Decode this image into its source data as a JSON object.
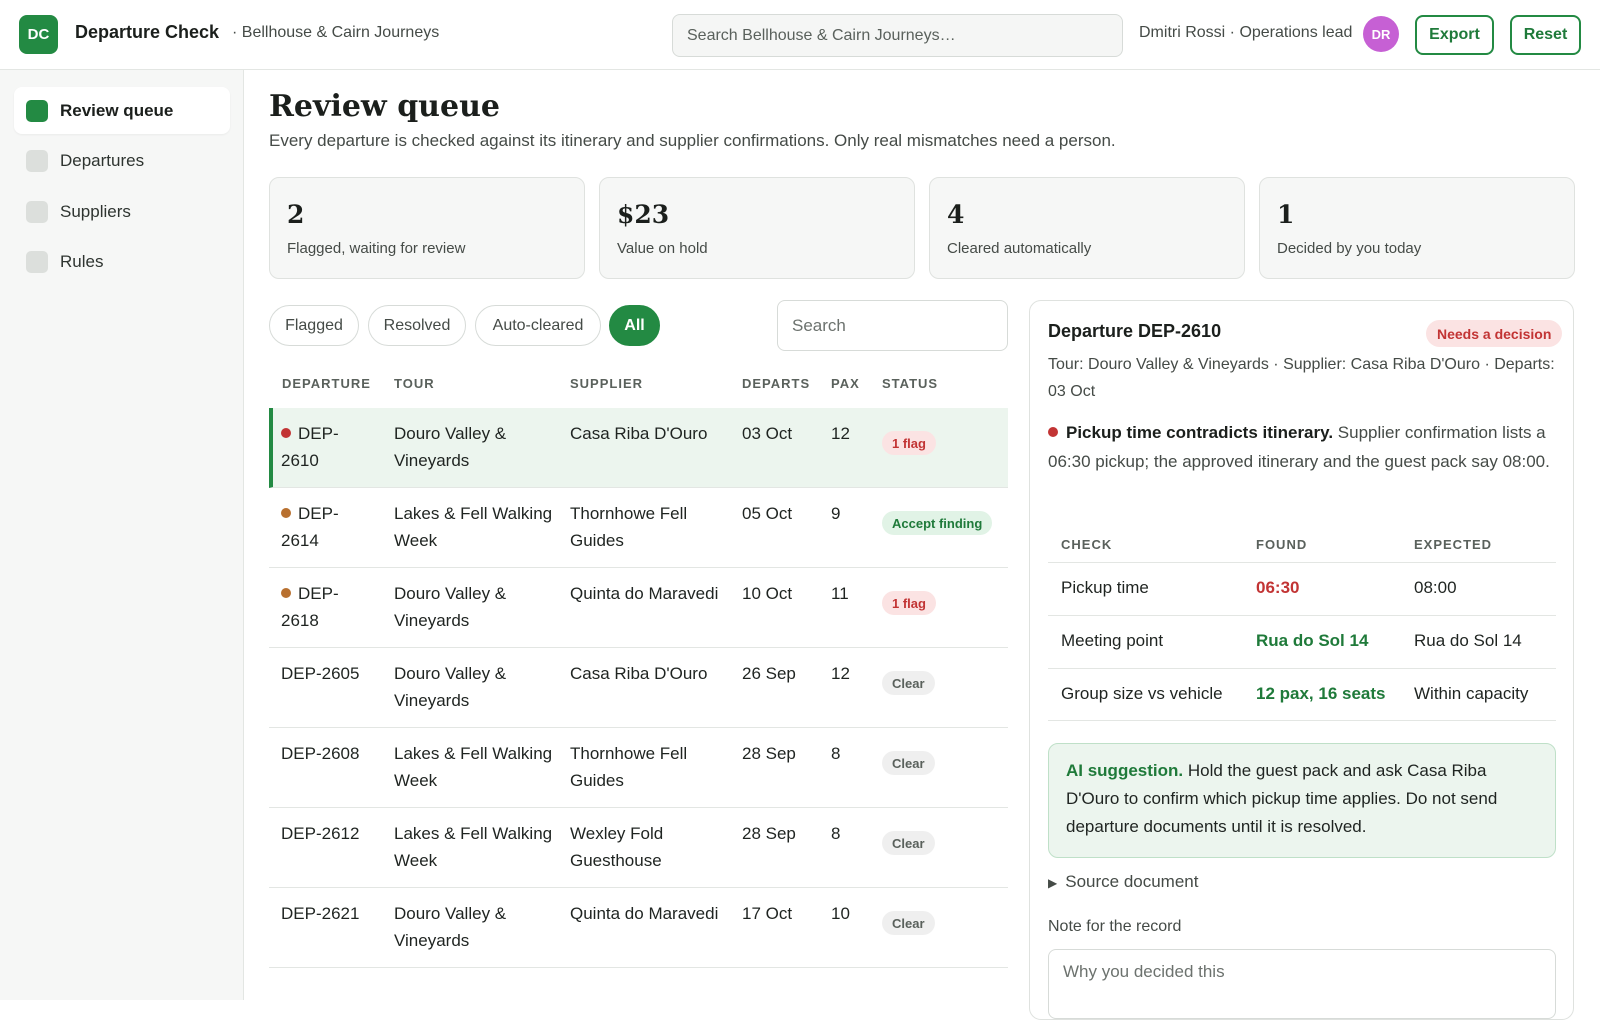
{
  "app": {
    "logo_initials": "DC",
    "name": "Departure Check",
    "org": "· Bellhouse & Cairn Journeys",
    "search_placeholder": "Search Bellhouse & Cairn Journeys…",
    "user": "Dmitri Rossi · Operations lead",
    "avatar_initials": "DR",
    "export_label": "Export",
    "reset_label": "Reset",
    "accent_color": "#238a43",
    "avatar_color": "#c660d4"
  },
  "sidebar": {
    "items": [
      {
        "label": "Review queue",
        "active": true
      },
      {
        "label": "Departures"
      },
      {
        "label": "Suppliers"
      },
      {
        "label": "Rules"
      }
    ]
  },
  "main": {
    "title": "Review queue",
    "subtitle": "Every departure is checked against its itinerary and supplier confirmations. Only real mismatches need a person.",
    "stats": [
      {
        "value": "2",
        "label": "Flagged, waiting for review"
      },
      {
        "value": "$23",
        "label": "Value on hold"
      },
      {
        "value": "4",
        "label": "Cleared automatically"
      },
      {
        "value": "1",
        "label": "Decided by you today"
      }
    ],
    "filters": [
      "Flagged",
      "Resolved",
      "Auto-cleared",
      "All"
    ],
    "active_filter": "All",
    "table_search_placeholder": "Search",
    "columns": [
      "DEPARTURE",
      "TOUR",
      "SUPPLIER",
      "DEPARTS",
      "PAX",
      "STATUS"
    ],
    "rows": [
      {
        "id": "DEP-2610",
        "tour": "Douro Valley & Vineyards",
        "supplier": "Casa Riba D'Ouro",
        "departs": "03 Oct",
        "pax": "12",
        "status": "1 flag",
        "status_kind": "flag",
        "dot": "#c23434",
        "selected": true
      },
      {
        "id": "DEP-2614",
        "tour": "Lakes & Fell Walking Week",
        "supplier": "Thornhowe Fell Guides",
        "departs": "05 Oct",
        "pax": "9",
        "status": "Accept finding",
        "status_kind": "accept",
        "dot": "#b8702f"
      },
      {
        "id": "DEP-2618",
        "tour": "Douro Valley & Vineyards",
        "supplier": "Quinta do Maravedi",
        "departs": "10 Oct",
        "pax": "11",
        "status": "1 flag",
        "status_kind": "flag",
        "dot": "#b8702f"
      },
      {
        "id": "DEP-2605",
        "tour": "Douro Valley & Vineyards",
        "supplier": "Casa Riba D'Ouro",
        "departs": "26 Sep",
        "pax": "12",
        "status": "Clear",
        "status_kind": "clear"
      },
      {
        "id": "DEP-2608",
        "tour": "Lakes & Fell Walking Week",
        "supplier": "Thornhowe Fell Guides",
        "departs": "28 Sep",
        "pax": "8",
        "status": "Clear",
        "status_kind": "clear"
      },
      {
        "id": "DEP-2612",
        "tour": "Lakes & Fell Walking Week",
        "supplier": "Wexley Fold Guesthouse",
        "departs": "28 Sep",
        "pax": "8",
        "status": "Clear",
        "status_kind": "clear"
      },
      {
        "id": "DEP-2621",
        "tour": "Douro Valley & Vineyards",
        "supplier": "Quinta do Maravedi",
        "departs": "17 Oct",
        "pax": "10",
        "status": "Clear",
        "status_kind": "clear"
      }
    ]
  },
  "detail": {
    "title": "Departure DEP-2610",
    "badge": "Needs a decision",
    "meta": "Tour: Douro Valley & Vineyards · Supplier: Casa Riba D'Ouro · Departs: 03 Oct",
    "finding_title": "Pickup time contradicts itinerary.",
    "finding_text": " Supplier confirmation lists a 06:30 pickup; the approved itinerary and the guest pack say 08:00.",
    "check_columns": [
      "CHECK",
      "FOUND",
      "EXPECTED"
    ],
    "checks": [
      {
        "check": "Pickup time",
        "found": "06:30",
        "expected": "08:00",
        "ok": false
      },
      {
        "check": "Meeting point",
        "found": "Rua do Sol 14",
        "expected": "Rua do Sol 14",
        "ok": true
      },
      {
        "check": "Group size vs vehicle",
        "found": "12 pax, 16 seats",
        "expected": "Within capacity",
        "ok": true
      }
    ],
    "ai_label": "AI suggestion.",
    "ai_text": " Hold the guest pack and ask Casa Riba D'Ouro to confirm which pickup time applies. Do not send departure documents until it is resolved.",
    "source_label": "Source document",
    "note_label": "Note for the record",
    "note_placeholder": "Why you decided this"
  }
}
